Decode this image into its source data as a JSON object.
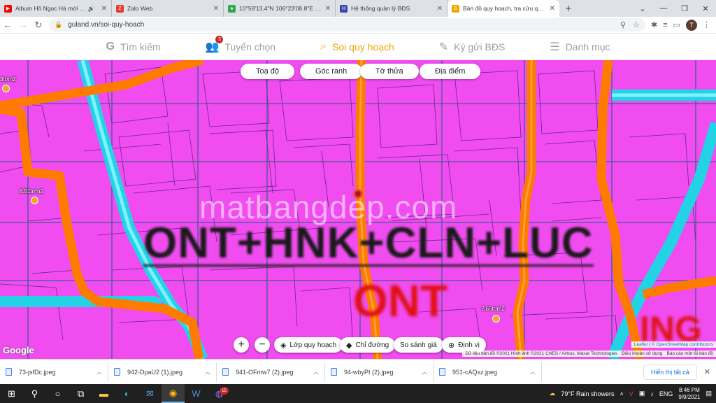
{
  "tabs": [
    {
      "title": "Album Hồ Ngọc Hà mới nhấ",
      "color": "#ff0000",
      "glyph": "▶"
    },
    {
      "title": "Zalo Web",
      "color": "#e53935",
      "glyph": "Z"
    },
    {
      "title": "10°59'13.4\"N 106°23'08.8\"E - Goo",
      "color": "#34a853",
      "glyph": "●"
    },
    {
      "title": "Hệ thống quản lý BĐS",
      "color": "#3949ab",
      "glyph": "H"
    },
    {
      "title": "Bản đồ quy hoạch, tra cứu quy h",
      "color": "#f0a500",
      "glyph": "G"
    }
  ],
  "url": "guland.vn/soi-quy-hoach",
  "avatar_letter": "T",
  "nav": [
    {
      "label": "Tìm kiếm",
      "icon": "G"
    },
    {
      "label": "Tuyển chọn",
      "icon": "👥",
      "badge": "3"
    },
    {
      "label": "Soi quy hoạch",
      "icon": "⌕"
    },
    {
      "label": "Ký gửi BĐS",
      "icon": "✎"
    },
    {
      "label": "Danh mục",
      "icon": "☰"
    }
  ],
  "map_tabs": [
    "Toạ độ",
    "Góc ranh",
    "Tờ thửa",
    "Địa điểm"
  ],
  "price_labels": [
    "3tr/m2",
    "8.51tr/m2",
    "7.65tr/m2"
  ],
  "watermark": "matbangdep.com",
  "zone_code": "ONT+HNK+CLN+LUC",
  "zone_ont": "ONT",
  "zone_partial": "ING",
  "google": "Google",
  "controls": {
    "zoom_in": "+",
    "zoom_out": "−",
    "layers": "Lớp quy hoạch",
    "directions": "Chỉ đường",
    "compare": "So sánh giá",
    "locate": "Định vị"
  },
  "attribution": {
    "leaflet": "Leaflet",
    "osm": "© OpenStreetMap contributors",
    "data": "Dữ liệu bản đồ ©2021 Hình ảnh ©2021 CNES / Airbus, Maxar Technologies",
    "terms": "Điều khoản sử dụng",
    "report": "Báo cáo một lỗi bản đồ"
  },
  "downloads": [
    "73-jsfDc.jpeg",
    "942-DpaU2 (1).jpeg",
    "941-OFmw7 (2).jpeg",
    "94-wbyPt (2).jpeg",
    "951-cAQxz.jpeg"
  ],
  "show_all": "Hiển thị tất cả",
  "taskbar": {
    "weather": "79°F  Rain showers",
    "lang": "ENG",
    "time": "8:46 PM",
    "date": "9/9/2021",
    "chat_badge": "15"
  }
}
